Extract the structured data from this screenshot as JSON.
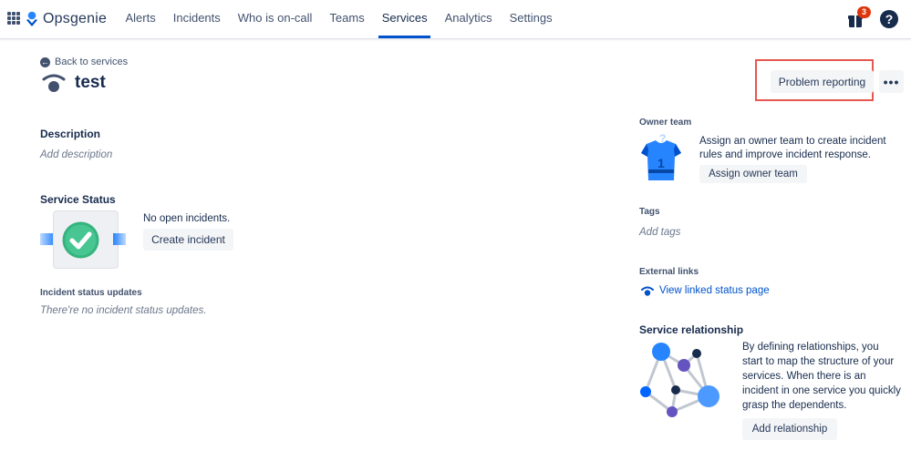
{
  "app": {
    "name": "Opsgenie"
  },
  "nav": {
    "items": [
      {
        "label": "Alerts"
      },
      {
        "label": "Incidents"
      },
      {
        "label": "Who is on-call"
      },
      {
        "label": "Teams"
      },
      {
        "label": "Services",
        "active": true
      },
      {
        "label": "Analytics"
      },
      {
        "label": "Settings"
      }
    ],
    "notifications_count": "3",
    "help_label": "?"
  },
  "page": {
    "back_label": "Back to services",
    "title": "test",
    "problem_reporting_label": "Problem reporting",
    "more_label": "•••"
  },
  "description": {
    "heading": "Description",
    "placeholder": "Add description"
  },
  "service_status": {
    "heading": "Service Status",
    "message": "No open incidents.",
    "create_button": "Create incident"
  },
  "incident_updates": {
    "heading": "Incident status updates",
    "empty": "There're no incident status updates."
  },
  "owner_team": {
    "heading": "Owner team",
    "text_line1": "Assign an owner team to create incident",
    "text_line2": "rules and improve incident response.",
    "button": "Assign owner team"
  },
  "tags": {
    "heading": "Tags",
    "placeholder": "Add tags"
  },
  "external_links": {
    "heading": "External links",
    "link": "View linked status page"
  },
  "service_relationship": {
    "heading": "Service relationship",
    "lines": [
      "By defining relationships, you",
      "start to map the structure of your",
      "services. When there is an",
      "incident in one service you quickly",
      "grasp the dependents."
    ],
    "button": "Add relationship"
  },
  "colors": {
    "accent": "#0052cc",
    "badge": "#de350b",
    "success": "#36b37e",
    "highlight": "#e5574f"
  }
}
